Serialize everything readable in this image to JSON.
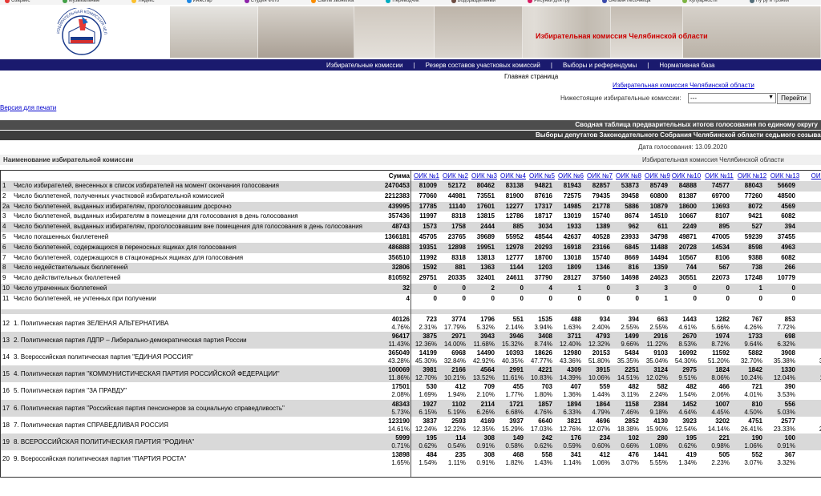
{
  "bookmarks": [
    {
      "label": "Озарьес",
      "color": "#e53935"
    },
    {
      "label": "Музыкальные",
      "color": "#43a047"
    },
    {
      "label": "Яндекс",
      "color": "#fbc02d"
    },
    {
      "label": "Инжстар",
      "color": "#1e88e5"
    },
    {
      "label": "Студия Фото",
      "color": "#8e24aa"
    },
    {
      "label": "Сайты звонилка",
      "color": "#fb8c00"
    },
    {
      "label": "Переводчик",
      "color": "#00acc1"
    },
    {
      "label": "Водораздельный",
      "color": "#6d4c41"
    },
    {
      "label": "Рисунки для гру",
      "color": "#d81b60"
    },
    {
      "label": "Онлайн песочница",
      "color": "#3949ab"
    },
    {
      "label": "Кулуарности",
      "color": "#7cb342"
    },
    {
      "label": "Ну ру и тронии",
      "color": "#546e7a"
    }
  ],
  "header": {
    "title": "Избирательная комиссия Челябинской области",
    "logo_text": "ИЗБИРАТЕЛЬНАЯ КОМИССИЯ ЧЕЛЯБИНСКОЙ ОБЛАСТИ"
  },
  "nav": {
    "items": [
      "Избирательные комиссии",
      "Резерв составов участковых комиссий",
      "Выборы и референдумы",
      "Нормативная база"
    ]
  },
  "breadcrumb": {
    "home": "Главная страница"
  },
  "commission_link": "Избирательная комиссия Челябинской области",
  "sub_commissions": {
    "label": "Нижестоящие избирательные комиссии:",
    "selected": "---",
    "go": "Перейти"
  },
  "print_link": "Версия для печати",
  "bars": {
    "summary": "Сводная таблица предварительных итогов голосования по единому округу",
    "election": "Выборы депутатов Законодательного Собрания Челябинской области седьмого созыва"
  },
  "vote_date": "Дата голосования:   13.09.2020",
  "name_header": {
    "left": "Наименование избирательной комиссии",
    "right": "Избирательная комиссия Челябинской области"
  },
  "table": {
    "sum_header": "Сумма",
    "columns": [
      "ОИК №1",
      "ОИК №2",
      "ОИК №3",
      "ОИК №4",
      "ОИК №5",
      "ОИК №6",
      "ОИК №7",
      "ОИК №8",
      "ОИК №9",
      "ОИК №10",
      "ОИК №11",
      "ОИК №12",
      "ОИК №13",
      "ОИК"
    ],
    "rows": [
      {
        "n": "1",
        "label": "Число избирателей, внесенных в список избирателей на момент окончания голосования",
        "sum": "2470453",
        "vals": [
          "81009",
          "52172",
          "80462",
          "83138",
          "94821",
          "81943",
          "82857",
          "53873",
          "85749",
          "84888",
          "74577",
          "88043",
          "56609",
          "97"
        ]
      },
      {
        "n": "2",
        "label": "Число бюллетеней, полученных участковой избирательной комиссией",
        "sum": "2212383",
        "vals": [
          "77060",
          "44981",
          "73551",
          "81900",
          "87616",
          "72575",
          "79435",
          "39458",
          "60800",
          "81387",
          "69700",
          "77260",
          "48500",
          "87"
        ]
      },
      {
        "n": "2а",
        "label": "Число бюллетеней, выданных избирателям, проголосовавшим досрочно",
        "sum": "439995",
        "vals": [
          "17785",
          "11140",
          "17601",
          "12277",
          "17317",
          "14985",
          "21778",
          "5886",
          "10879",
          "18600",
          "13693",
          "8072",
          "4569",
          "7"
        ]
      },
      {
        "n": "3",
        "label": "Число бюллетеней, выданных избирателям в помещении для голосования в день голосования",
        "sum": "357436",
        "vals": [
          "11997",
          "8318",
          "13815",
          "12786",
          "18717",
          "13019",
          "15740",
          "8674",
          "14510",
          "10667",
          "8107",
          "9421",
          "6082",
          "11"
        ]
      },
      {
        "n": "4",
        "label": "Число бюллетеней, выданных избирателям, проголосовавшим вне помещения для голосования в день голосования",
        "sum": "48743",
        "vals": [
          "1573",
          "1758",
          "2444",
          "885",
          "3034",
          "1933",
          "1389",
          "962",
          "611",
          "2249",
          "895",
          "527",
          "394",
          ""
        ]
      },
      {
        "n": "5",
        "label": "Число погашенных бюллетеней",
        "sum": "1366181",
        "vals": [
          "45705",
          "23765",
          "39689",
          "55952",
          "48544",
          "42637",
          "40528",
          "23933",
          "34798",
          "49871",
          "47005",
          "59239",
          "37455",
          "67"
        ]
      },
      {
        "n": "6",
        "label": "Число бюллетеней, содержащихся в переносных ящиках для голосования",
        "sum": "486888",
        "vals": [
          "19351",
          "12898",
          "19951",
          "12978",
          "20293",
          "16918",
          "23166",
          "6845",
          "11488",
          "20728",
          "14534",
          "8598",
          "4963",
          "8"
        ]
      },
      {
        "n": "7",
        "label": "Число бюллетеней, содержащихся в стационарных ящиках для голосования",
        "sum": "356510",
        "vals": [
          "11992",
          "8318",
          "13813",
          "12777",
          "18700",
          "13018",
          "15740",
          "8669",
          "14494",
          "10567",
          "8106",
          "9388",
          "6082",
          "11"
        ]
      },
      {
        "n": "8",
        "label": "Число недействительных бюллетеней",
        "sum": "32806",
        "vals": [
          "1592",
          "881",
          "1363",
          "1144",
          "1203",
          "1809",
          "1346",
          "816",
          "1359",
          "744",
          "567",
          "738",
          "266",
          ""
        ]
      },
      {
        "n": "9",
        "label": "Число действительных бюллетеней",
        "sum": "810592",
        "vals": [
          "29751",
          "20335",
          "32401",
          "24611",
          "37790",
          "28127",
          "37560",
          "14698",
          "24623",
          "30551",
          "22073",
          "17248",
          "10779",
          "19"
        ]
      },
      {
        "n": "10",
        "label": "Число утраченных бюллетеней",
        "sum": "32",
        "vals": [
          "0",
          "0",
          "2",
          "0",
          "4",
          "1",
          "0",
          "3",
          "3",
          "0",
          "0",
          "1",
          "0",
          ""
        ]
      },
      {
        "n": "11",
        "label": "Число бюллетеней, не учтенных при получении",
        "sum": "4",
        "vals": [
          "0",
          "0",
          "0",
          "0",
          "0",
          "0",
          "0",
          "0",
          "1",
          "0",
          "0",
          "0",
          "0",
          ""
        ]
      }
    ],
    "party_rows": [
      {
        "n": "12",
        "label": "1. Политическая партия ЗЕЛЕНАЯ АЛЬТЕРНАТИВА",
        "sum": "40126",
        "sum_pct": "4.76%",
        "vals": [
          "723",
          "3774",
          "1796",
          "551",
          "1535",
          "488",
          "934",
          "394",
          "663",
          "1443",
          "1282",
          "767",
          "853",
          "1"
        ],
        "pcts": [
          "2.31%",
          "17.79%",
          "5.32%",
          "2.14%",
          "3.94%",
          "1.63%",
          "2.40%",
          "2.55%",
          "2.55%",
          "4.61%",
          "5.66%",
          "4.26%",
          "7.72%",
          "5."
        ]
      },
      {
        "n": "13",
        "label": "2. Политическая партия ЛДПР – Либерально-демократическая партия России",
        "sum": "96417",
        "sum_pct": "11.43%",
        "vals": [
          "3875",
          "2971",
          "3943",
          "3946",
          "3408",
          "3711",
          "4793",
          "1499",
          "2916",
          "2670",
          "1974",
          "1733",
          "698",
          "1"
        ],
        "pcts": [
          "12.36%",
          "14.00%",
          "11.68%",
          "15.32%",
          "8.74%",
          "12.40%",
          "12.32%",
          "9.66%",
          "11.22%",
          "8.53%",
          "8.72%",
          "9.64%",
          "6.32%",
          "7."
        ]
      },
      {
        "n": "14",
        "label": "3. Всероссийская политическая партия \"ЕДИНАЯ РОССИЯ\"",
        "sum": "365049",
        "sum_pct": "43.28%",
        "vals": [
          "14199",
          "6968",
          "14490",
          "10393",
          "18626",
          "12980",
          "20153",
          "5484",
          "9103",
          "16992",
          "11592",
          "5882",
          "3908",
          "7"
        ],
        "pcts": [
          "45.30%",
          "32.84%",
          "42.92%",
          "40.35%",
          "47.77%",
          "43.36%",
          "51.80%",
          "35.35%",
          "35.04%",
          "54.30%",
          "51.20%",
          "32.70%",
          "35.38%",
          "39."
        ]
      },
      {
        "n": "15",
        "label": "4. Политическая партия \"КОММУНИСТИЧЕСКАЯ ПАРТИЯ РОССИЙСКОЙ ФЕДЕРАЦИИ\"",
        "sum": "100069",
        "sum_pct": "11.86%",
        "vals": [
          "3981",
          "2166",
          "4564",
          "2991",
          "4221",
          "4309",
          "3915",
          "2251",
          "3124",
          "2975",
          "1824",
          "1842",
          "1330",
          "2"
        ],
        "pcts": [
          "12.70%",
          "10.21%",
          "13.52%",
          "11.61%",
          "10.83%",
          "14.39%",
          "10.06%",
          "14.51%",
          "12.02%",
          "9.51%",
          "8.06%",
          "10.24%",
          "12.04%",
          "11."
        ]
      },
      {
        "n": "16",
        "label": "5. Политическая партия \"ЗА ПРАВДУ\"",
        "sum": "17501",
        "sum_pct": "2.08%",
        "vals": [
          "530",
          "412",
          "709",
          "455",
          "703",
          "407",
          "559",
          "482",
          "582",
          "482",
          "466",
          "721",
          "390",
          ""
        ],
        "pcts": [
          "1.69%",
          "1.94%",
          "2.10%",
          "1.77%",
          "1.80%",
          "1.36%",
          "1.44%",
          "3.11%",
          "2.24%",
          "1.54%",
          "2.06%",
          "4.01%",
          "3.53%",
          "3."
        ]
      },
      {
        "n": "17",
        "label": "6. Политическая партия \"Российская партия пенсионеров за социальную справедливость\"",
        "sum": "48343",
        "sum_pct": "5.73%",
        "vals": [
          "1927",
          "1102",
          "2114",
          "1721",
          "1857",
          "1894",
          "1864",
          "1158",
          "2384",
          "1452",
          "1007",
          "810",
          "556",
          "1"
        ],
        "pcts": [
          "6.15%",
          "5.19%",
          "6.26%",
          "6.68%",
          "4.76%",
          "6.33%",
          "4.79%",
          "7.46%",
          "9.18%",
          "4.64%",
          "4.45%",
          "4.50%",
          "5.03%",
          "5."
        ]
      },
      {
        "n": "18",
        "label": "7. Политическая партия СПРАВЕДЛИВАЯ РОССИЯ",
        "sum": "123190",
        "sum_pct": "14.61%",
        "vals": [
          "3837",
          "2593",
          "4169",
          "3937",
          "6640",
          "3821",
          "4696",
          "2852",
          "4130",
          "3923",
          "3202",
          "4751",
          "2577",
          "4"
        ],
        "pcts": [
          "12.24%",
          "12.22%",
          "12.35%",
          "15.29%",
          "17.03%",
          "12.76%",
          "12.07%",
          "18.38%",
          "15.90%",
          "12.54%",
          "14.14%",
          "26.41%",
          "23.33%",
          "22."
        ]
      },
      {
        "n": "19",
        "label": "8. ВСЕРОССИЙСКАЯ ПОЛИТИЧЕСКАЯ ПАРТИЯ \"РОДИНА\"",
        "sum": "5999",
        "sum_pct": "0.71%",
        "vals": [
          "195",
          "114",
          "308",
          "149",
          "242",
          "176",
          "234",
          "102",
          "280",
          "195",
          "221",
          "190",
          "100",
          ""
        ],
        "pcts": [
          "0.62%",
          "0.54%",
          "0.91%",
          "0.58%",
          "0.62%",
          "0.59%",
          "0.60%",
          "0.66%",
          "1.08%",
          "0.62%",
          "0.98%",
          "1.06%",
          "0.91%",
          "0."
        ]
      },
      {
        "n": "20",
        "label": "9. Всероссийская политическая партия \"ПАРТИЯ РОСТА\"",
        "sum": "13898",
        "sum_pct": "1.65%",
        "vals": [
          "484",
          "235",
          "308",
          "468",
          "558",
          "341",
          "412",
          "476",
          "1441",
          "419",
          "505",
          "552",
          "367",
          ""
        ],
        "pcts": [
          "1.54%",
          "1.11%",
          "0.91%",
          "1.82%",
          "1.43%",
          "1.14%",
          "1.06%",
          "3.07%",
          "5.55%",
          "1.34%",
          "2.23%",
          "3.07%",
          "3.32%",
          "3."
        ]
      }
    ]
  }
}
